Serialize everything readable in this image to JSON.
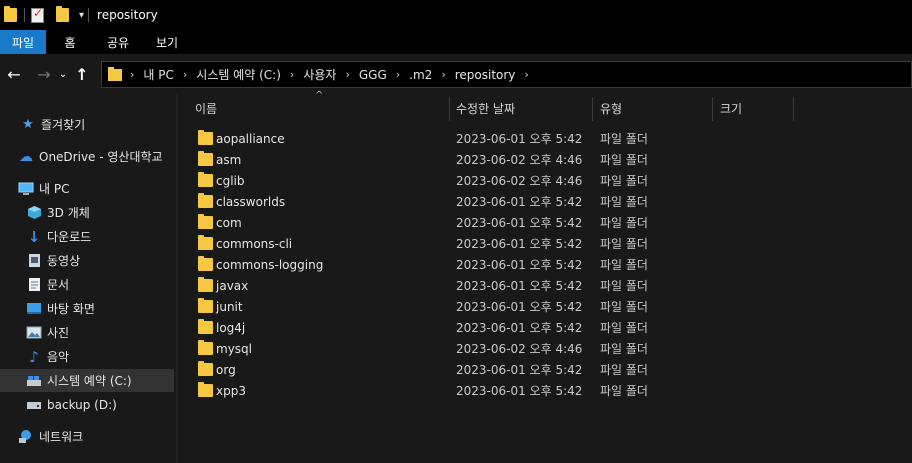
{
  "titlebar": {
    "title": "repository"
  },
  "ribbon": {
    "tabs": [
      "파일",
      "홈",
      "공유",
      "보기"
    ]
  },
  "nav": {
    "breadcrumbs": [
      "내 PC",
      "시스템 예약 (C:)",
      "사용자",
      "GGG",
      ".m2",
      "repository"
    ]
  },
  "sidebar": {
    "items": [
      {
        "label": "즐겨찾기",
        "icon": "star-icon"
      },
      {
        "label": "OneDrive - 영산대학교",
        "icon": "cloud-icon"
      },
      {
        "label": "내 PC",
        "icon": "pc-icon"
      },
      {
        "label": "3D 개체",
        "icon": "cube-icon"
      },
      {
        "label": "다운로드",
        "icon": "download-icon"
      },
      {
        "label": "동영상",
        "icon": "video-icon"
      },
      {
        "label": "문서",
        "icon": "document-icon"
      },
      {
        "label": "바탕 화면",
        "icon": "desktop-icon"
      },
      {
        "label": "사진",
        "icon": "picture-icon"
      },
      {
        "label": "음악",
        "icon": "music-icon"
      },
      {
        "label": "시스템 예약 (C:)",
        "icon": "drive-icon"
      },
      {
        "label": "backup (D:)",
        "icon": "drive-icon"
      },
      {
        "label": "네트워크",
        "icon": "network-icon"
      }
    ]
  },
  "columns": {
    "name": "이름",
    "date": "수정한 날짜",
    "type": "유형",
    "size": "크기"
  },
  "files": [
    {
      "name": "aopalliance",
      "date": "2023-06-01 오후 5:42",
      "type": "파일 폴더"
    },
    {
      "name": "asm",
      "date": "2023-06-02 오후 4:46",
      "type": "파일 폴더"
    },
    {
      "name": "cglib",
      "date": "2023-06-02 오후 4:46",
      "type": "파일 폴더"
    },
    {
      "name": "classworlds",
      "date": "2023-06-01 오후 5:42",
      "type": "파일 폴더"
    },
    {
      "name": "com",
      "date": "2023-06-01 오후 5:42",
      "type": "파일 폴더"
    },
    {
      "name": "commons-cli",
      "date": "2023-06-01 오후 5:42",
      "type": "파일 폴더"
    },
    {
      "name": "commons-logging",
      "date": "2023-06-01 오후 5:42",
      "type": "파일 폴더"
    },
    {
      "name": "javax",
      "date": "2023-06-01 오후 5:42",
      "type": "파일 폴더"
    },
    {
      "name": "junit",
      "date": "2023-06-01 오후 5:42",
      "type": "파일 폴더"
    },
    {
      "name": "log4j",
      "date": "2023-06-01 오후 5:42",
      "type": "파일 폴더"
    },
    {
      "name": "mysql",
      "date": "2023-06-02 오후 4:46",
      "type": "파일 폴더"
    },
    {
      "name": "org",
      "date": "2023-06-01 오후 5:42",
      "type": "파일 폴더"
    },
    {
      "name": "xpp3",
      "date": "2023-06-01 오후 5:42",
      "type": "파일 폴더"
    }
  ],
  "colors": {
    "accent": "#1979ca",
    "folder": "#f5c842",
    "background": "#191919"
  }
}
